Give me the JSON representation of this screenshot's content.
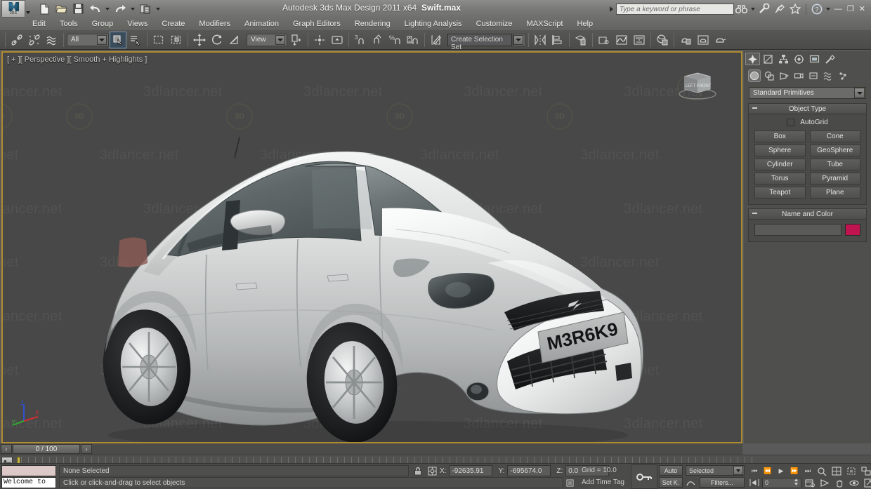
{
  "titlebar": {
    "app_title": "Autodesk 3ds Max Design 2011 x64",
    "file_title": "Swift.max",
    "logo_label": "3DS",
    "search_placeholder": "Type a keyword or phrase",
    "minimize": "—",
    "maximize": "❐",
    "close": "✕",
    "quick_access": [
      {
        "name": "new-file-icon",
        "title": "New"
      },
      {
        "name": "open-file-icon",
        "title": "Open"
      },
      {
        "name": "save-file-icon",
        "title": "Save"
      },
      {
        "name": "undo-icon",
        "title": "Undo"
      },
      {
        "name": "redo-icon",
        "title": "Redo"
      },
      {
        "name": "project-folder-icon",
        "title": "Set Project Folder"
      }
    ],
    "right_icons": [
      {
        "name": "binoculars-search-icon",
        "title": "Search"
      },
      {
        "name": "wrench-icon",
        "title": "Tools"
      },
      {
        "name": "satellite-icon",
        "title": "Communication Center"
      },
      {
        "name": "star-favorites-icon",
        "title": "Favorites"
      },
      {
        "name": "help-question-icon",
        "title": "Help"
      }
    ]
  },
  "menu": {
    "items": [
      "Edit",
      "Tools",
      "Group",
      "Views",
      "Create",
      "Modifiers",
      "Animation",
      "Graph Editors",
      "Rendering",
      "Lighting Analysis",
      "Customize",
      "MAXScript",
      "Help"
    ]
  },
  "toolbar": {
    "selection_filter": "All",
    "reference_coord": "View",
    "named_selection_set": "Create Selection Set",
    "axis_constraint_label": "3",
    "icons": [
      {
        "name": "select-link-icon",
        "title": "Select and Link"
      },
      {
        "name": "unlink-icon",
        "title": "Unlink Selection"
      },
      {
        "name": "bind-space-warp-icon",
        "title": "Bind to Space Warp"
      },
      {
        "name": "select-object-icon",
        "title": "Select Object"
      },
      {
        "name": "select-by-name-icon",
        "title": "Select by Name"
      },
      {
        "name": "rectangular-selection-region-icon",
        "title": "Rectangular Selection Region"
      },
      {
        "name": "window-crossing-icon",
        "title": "Window / Crossing"
      },
      {
        "name": "select-and-move-icon",
        "title": "Select and Move"
      },
      {
        "name": "select-and-rotate-icon",
        "title": "Select and Rotate"
      },
      {
        "name": "select-and-scale-icon",
        "title": "Select and Uniform Scale"
      },
      {
        "name": "use-center-icon",
        "title": "Use Pivot Point Center"
      },
      {
        "name": "select-and-manipulate-icon",
        "title": "Select and Manipulate"
      },
      {
        "name": "snaps-toggle-icon",
        "title": "Snaps Toggle"
      },
      {
        "name": "angle-snap-icon",
        "title": "Angle Snap Toggle"
      },
      {
        "name": "percent-snap-icon",
        "title": "Percent Snap Toggle"
      },
      {
        "name": "spinner-snap-icon",
        "title": "Spinner Snap Toggle"
      },
      {
        "name": "edit-named-selection-icon",
        "title": "Edit Named Selection Sets"
      },
      {
        "name": "mirror-icon",
        "title": "Mirror"
      },
      {
        "name": "align-icon",
        "title": "Align"
      },
      {
        "name": "layer-manager-icon",
        "title": "Layer Manager"
      },
      {
        "name": "graphite-toolbar-icon",
        "title": "Toggle Ribbon"
      },
      {
        "name": "curve-editor-icon",
        "title": "Curve Editor"
      },
      {
        "name": "schematic-view-icon",
        "title": "Schematic View"
      },
      {
        "name": "material-editor-icon",
        "title": "Material Editor"
      },
      {
        "name": "render-setup-icon",
        "title": "Render Setup"
      },
      {
        "name": "rendered-frame-window-icon",
        "title": "Rendered Frame Window"
      },
      {
        "name": "render-production-icon",
        "title": "Render Production"
      }
    ]
  },
  "viewport": {
    "label": "[ + ][ Perspective ][ Smooth + Highlights ]",
    "background_color": "#474847",
    "border_color": "#b08b30",
    "watermark_text": "3dlancer.net",
    "watermark_logo": "3D",
    "license_plate": "M3R6K9",
    "axis_labels": {
      "x": "X",
      "y": "Y",
      "z": "Z"
    },
    "axis_colors": {
      "x": "#d03030",
      "y": "#30b030",
      "z": "#3050d0"
    },
    "viewcube_faces": [
      "LEFT",
      "FRONT"
    ]
  },
  "timeline": {
    "slider_label": "0 / 100",
    "prev_frame": "‹",
    "next_frame": "›"
  },
  "status": {
    "maxscript_listener_text": "Welcome to",
    "selection_status": "None Selected",
    "prompt": "Click or click-and-drag to select objects",
    "coordinates": {
      "x_label": "X:",
      "x_value": "-92635.91",
      "y_label": "Y:",
      "y_value": "-695674.0",
      "z_label": "Z:",
      "z_value": "0.0"
    },
    "grid_label": "Grid = 10.0",
    "add_time_tag": "Add Time Tag",
    "auto_key": "Auto",
    "set_key": "Set K.",
    "key_filter_mode": "Selected",
    "filters_label": "Filters...",
    "current_frame": "0",
    "playback": [
      {
        "name": "goto-start-button",
        "glyph": "⏮"
      },
      {
        "name": "previous-frame-button",
        "glyph": "⏪"
      },
      {
        "name": "play-animation-button",
        "glyph": "▶"
      },
      {
        "name": "next-frame-button",
        "glyph": "⏩"
      },
      {
        "name": "goto-end-button",
        "glyph": "⏭"
      }
    ],
    "viewport_controls": [
      {
        "name": "zoom-icon",
        "title": "Zoom"
      },
      {
        "name": "zoom-all-icon",
        "title": "Zoom All"
      },
      {
        "name": "zoom-extents-icon",
        "title": "Zoom Extents"
      },
      {
        "name": "zoom-region-icon",
        "title": "Zoom Region"
      },
      {
        "name": "field-of-view-icon",
        "title": "Field of View"
      },
      {
        "name": "pan-hand-icon",
        "title": "Pan View"
      },
      {
        "name": "orbit-icon",
        "title": "Orbit"
      },
      {
        "name": "maximize-viewport-icon",
        "title": "Maximize Viewport Toggle"
      }
    ]
  },
  "command_panel": {
    "tabs": [
      {
        "name": "create-tab",
        "title": "Create",
        "active": true
      },
      {
        "name": "modify-tab",
        "title": "Modify",
        "active": false
      },
      {
        "name": "hierarchy-tab",
        "title": "Hierarchy",
        "active": false
      },
      {
        "name": "motion-tab",
        "title": "Motion",
        "active": false
      },
      {
        "name": "display-tab",
        "title": "Display",
        "active": false
      },
      {
        "name": "utilities-tab",
        "title": "Utilities",
        "active": false
      }
    ],
    "categories": [
      {
        "name": "geometry-category-icon",
        "title": "Geometry",
        "active": true
      },
      {
        "name": "shapes-category-icon",
        "title": "Shapes",
        "active": false
      },
      {
        "name": "lights-category-icon",
        "title": "Lights",
        "active": false
      },
      {
        "name": "cameras-category-icon",
        "title": "Cameras",
        "active": false
      },
      {
        "name": "helpers-category-icon",
        "title": "Helpers",
        "active": false
      },
      {
        "name": "space-warps-category-icon",
        "title": "Space Warps",
        "active": false
      },
      {
        "name": "systems-category-icon",
        "title": "Systems",
        "active": false
      }
    ],
    "primitive_type": "Standard Primitives",
    "object_type": {
      "title": "Object Type",
      "autogrid_label": "AutoGrid",
      "autogrid_checked": false,
      "buttons": [
        "Box",
        "Cone",
        "Sphere",
        "GeoSphere",
        "Cylinder",
        "Tube",
        "Torus",
        "Pyramid",
        "Teapot",
        "Plane"
      ]
    },
    "name_and_color": {
      "title": "Name and Color",
      "name_value": "",
      "color": "#bf1450"
    }
  }
}
